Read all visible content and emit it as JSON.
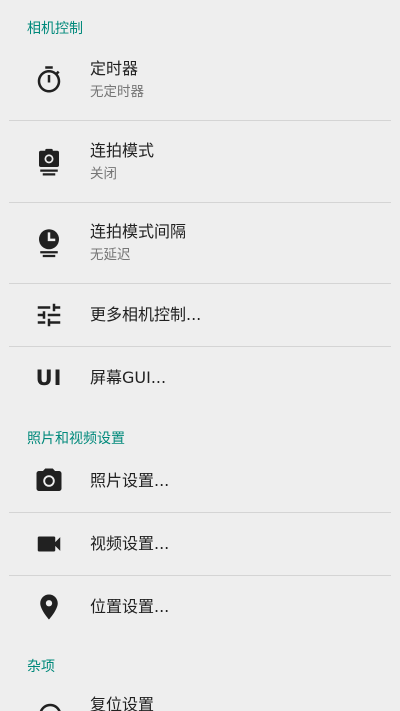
{
  "sections": {
    "camera_control": "相机控制",
    "photo_video": "照片和视频设置",
    "misc": "杂项"
  },
  "items": {
    "timer": {
      "title": "定时器",
      "summary": "无定时器",
      "icon": "timer-icon"
    },
    "burst_mode": {
      "title": "连拍模式",
      "summary": "关闭",
      "icon": "burst-camera-icon"
    },
    "burst_interval": {
      "title": "连拍模式间隔",
      "summary": "无延迟",
      "icon": "clock-interval-icon"
    },
    "more_camera": {
      "title": "更多相机控制...",
      "icon": "sliders-icon"
    },
    "gui": {
      "title": "屏幕GUI...",
      "icon": "ui-icon",
      "icon_text": "UI"
    },
    "photo_settings": {
      "title": "照片设置...",
      "icon": "camera-icon"
    },
    "video_settings": {
      "title": "视频设置...",
      "icon": "videocam-icon"
    },
    "location_settings": {
      "title": "位置设置...",
      "icon": "location-pin-icon"
    },
    "reset_settings": {
      "title": "复位设置",
      "icon": "reset-icon"
    }
  },
  "colors": {
    "accent": "#00897b",
    "background": "#eeeeee",
    "primary_text": "#212121",
    "secondary_text": "#757575",
    "divider": "#d4d4d4"
  }
}
